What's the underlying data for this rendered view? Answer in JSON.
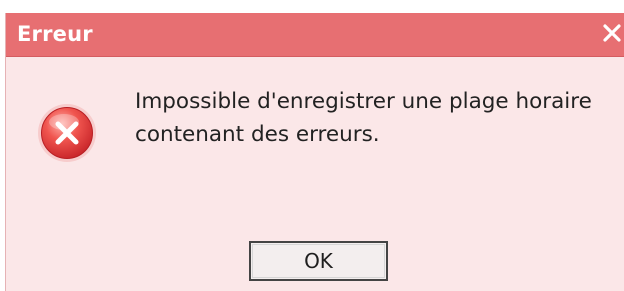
{
  "dialog": {
    "title": "Erreur",
    "close_glyph": "✕",
    "icon": "error-circle-x-icon",
    "message_lines": [
      "Impossible d'enregistrer une plage horaire",
      "contenant des erreurs."
    ],
    "ok_label": "OK"
  },
  "colors": {
    "titlebar": "#e76f72",
    "dialog_background": "#fbe7e8",
    "icon_red": "#e2383a"
  }
}
